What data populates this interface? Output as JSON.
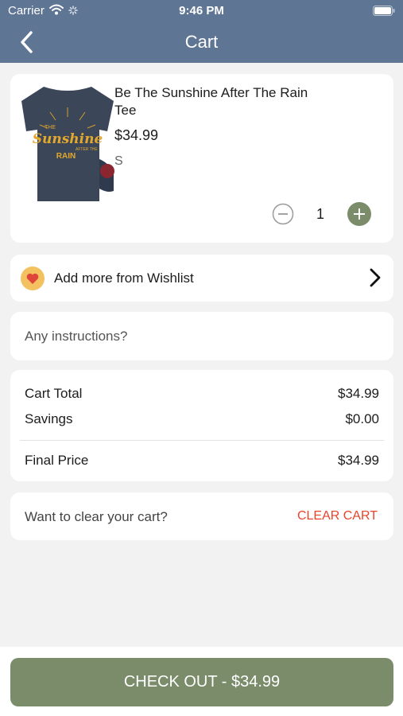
{
  "status_bar": {
    "carrier": "Carrier",
    "time": "9:46 PM",
    "icons": [
      "wifi-icon",
      "spinner-icon",
      "battery-icon"
    ]
  },
  "nav": {
    "title": "Cart",
    "back_icon": "chevron-left-icon"
  },
  "cart_item": {
    "name": "Be The Sunshine After The Rain Tee",
    "price": "$34.99",
    "size": "S",
    "quantity": "1",
    "image_text": [
      "THE",
      "Sunshine",
      "AFTER THE",
      "RAIN"
    ],
    "image_icon": "t-shirt-icon"
  },
  "wishlist": {
    "label": "Add more from Wishlist",
    "icon": "heart-icon",
    "chevron": "chevron-right-icon"
  },
  "instructions": {
    "placeholder": "Any instructions?",
    "value": ""
  },
  "totals": {
    "cart_total_label": "Cart Total",
    "cart_total_value": "$34.99",
    "savings_label": "Savings",
    "savings_value": "$0.00",
    "final_label": "Final Price",
    "final_value": "$34.99"
  },
  "clear_cart": {
    "prompt": "Want to clear your cart?",
    "button": "CLEAR CART"
  },
  "checkout": {
    "label": "CHECK OUT - $34.99"
  },
  "colors": {
    "header": "#5f7594",
    "accent_green": "#7b8c6a",
    "clear_red": "#e8452c",
    "background": "#f2f2f2"
  }
}
